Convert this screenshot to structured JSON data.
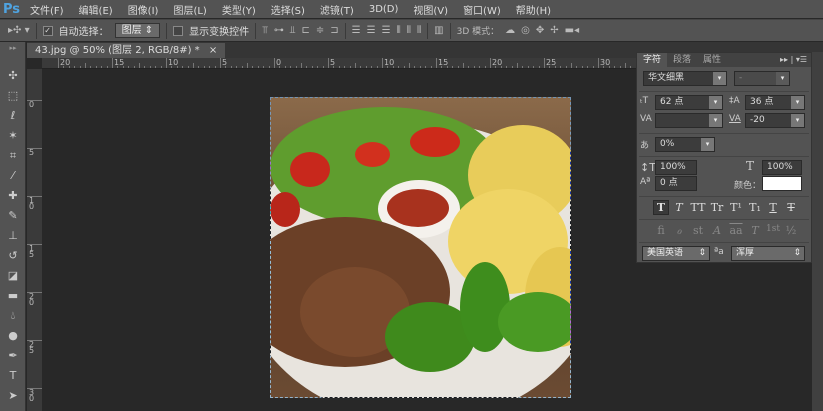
{
  "app": {
    "logo": "Ps"
  },
  "menu": [
    "文件(F)",
    "编辑(E)",
    "图像(I)",
    "图层(L)",
    "类型(Y)",
    "选择(S)",
    "滤镜(T)",
    "3D(D)",
    "视图(V)",
    "窗口(W)",
    "帮助(H)"
  ],
  "options": {
    "auto_select_label": "自动选择：",
    "auto_select_checked": true,
    "auto_select_value": "图层",
    "show_transform_label": "显示变换控件",
    "show_transform_checked": false,
    "mode_3d_label": "3D 模式："
  },
  "document_tab": {
    "title": "43.jpg @ 50% (图层 2, RGB/8#) *",
    "close": "×"
  },
  "ruler": {
    "h_labels": [
      "20",
      "15",
      "10",
      "5",
      "0",
      "5",
      "10",
      "15",
      "20",
      "25",
      "30"
    ],
    "v_labels": [
      "0",
      "5",
      "1 0",
      "1 5",
      "2 0",
      "2 5",
      "3 0"
    ]
  },
  "character_panel": {
    "tabs": [
      "字符",
      "段落",
      "属性"
    ],
    "font_family": "华文细黑",
    "font_style": "-",
    "font_size": "62 点",
    "leading": "36 点",
    "kerning": "",
    "tracking": "-20",
    "tsume": "0%",
    "vertical_scale": "100%",
    "horizontal_scale": "100%",
    "baseline_shift": "0 点",
    "color_label": "颜色：",
    "color": "#ffffff",
    "style_buttons": [
      "T",
      "T",
      "TT",
      "Tr",
      "T¹",
      "T₁",
      "T",
      "T"
    ],
    "opentype_buttons": [
      "fi",
      "ℴ",
      "st",
      "A",
      "aa",
      "T",
      "1st",
      "½"
    ],
    "language": "美国英语",
    "aa_label": "ªa",
    "antialias": "浑厚"
  }
}
